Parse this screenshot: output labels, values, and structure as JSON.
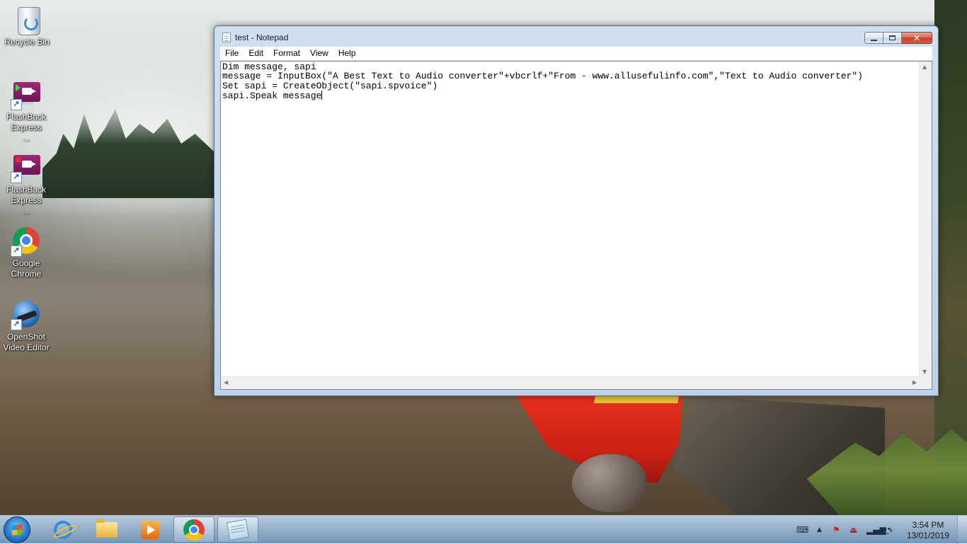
{
  "desktop": {
    "icons": [
      {
        "label": "Recycle Bin",
        "icon": "recycle-bin-icon"
      },
      {
        "label": "FlashBack Express ...",
        "icon": "flashback-player-icon"
      },
      {
        "label": "FlashBack Express ...",
        "icon": "flashback-recorder-icon"
      },
      {
        "label": "Google Chrome",
        "icon": "chrome-icon"
      },
      {
        "label": "OpenShot Video Editor",
        "icon": "openshot-icon"
      }
    ]
  },
  "window": {
    "title": "test - Notepad",
    "menu": [
      "File",
      "Edit",
      "Format",
      "View",
      "Help"
    ],
    "content": {
      "lines": [
        "Dim message, sapi",
        "message = InputBox(\"A Best Text to Audio converter\"+vbcrlf+\"From - www.allusefulinfo.com\",\"Text to Audio converter\")",
        "Set sapi = CreateObject(\"sapi.spvoice\")",
        "sapi.Speak message"
      ]
    }
  },
  "taskbar": {
    "pinned": [
      "internet-explorer-icon",
      "file-explorer-icon",
      "media-player-icon",
      "chrome-icon",
      "notepad-icon"
    ],
    "clock": {
      "time": "3:54 PM",
      "date": "13/01/2019"
    }
  }
}
